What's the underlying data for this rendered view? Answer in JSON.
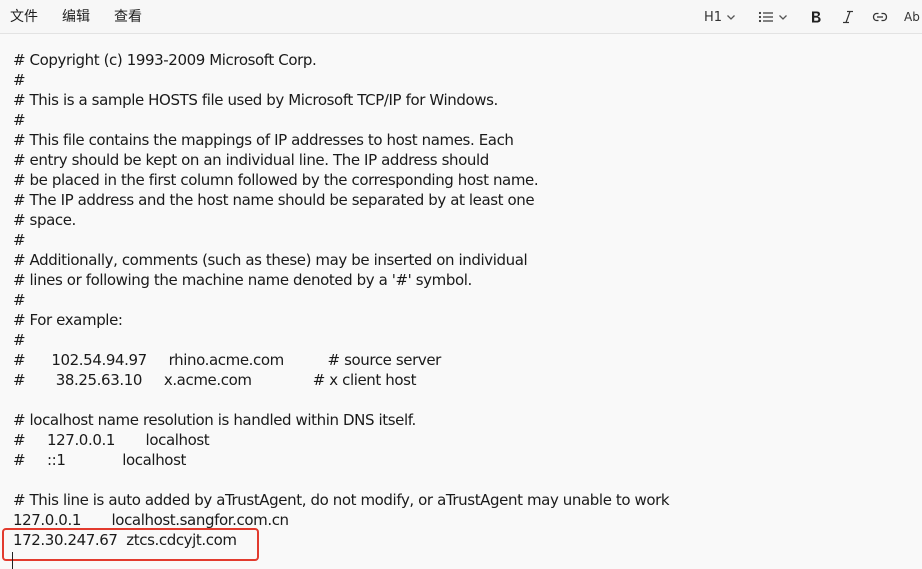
{
  "menu": {
    "items": [
      "文件",
      "编辑",
      "查看"
    ]
  },
  "toolbar": {
    "heading_label": "H1",
    "icons": [
      "list-icon",
      "bold-icon",
      "italic-icon",
      "link-icon",
      "spellcheck-icon"
    ],
    "spell_label": "Ab"
  },
  "editor": {
    "lines": [
      "# Copyright (c) 1993-2009 Microsoft Corp.",
      "#",
      "# This is a sample HOSTS file used by Microsoft TCP/IP for Windows.",
      "#",
      "# This file contains the mappings of IP addresses to host names. Each",
      "# entry should be kept on an individual line. The IP address should",
      "# be placed in the first column followed by the corresponding host name.",
      "# The IP address and the host name should be separated by at least one",
      "# space.",
      "#",
      "# Additionally, comments (such as these) may be inserted on individual",
      "# lines or following the machine name denoted by a '#' symbol.",
      "#",
      "# For example:",
      "#",
      "#      102.54.94.97     rhino.acme.com          # source server",
      "#       38.25.63.10     x.acme.com              # x client host",
      "",
      "# localhost name resolution is handled within DNS itself.",
      "#     127.0.0.1       localhost",
      "#     ::1             localhost",
      "",
      "# This line is auto added by aTrustAgent, do not modify, or aTrustAgent may unable to work",
      "127.0.0.1       localhost.sangfor.com.cn",
      "172.30.247.67  ztcs.cdcyjt.com",
      ""
    ]
  },
  "colors": {
    "highlight": "#e23b2e",
    "background": "#f9f9f9"
  }
}
